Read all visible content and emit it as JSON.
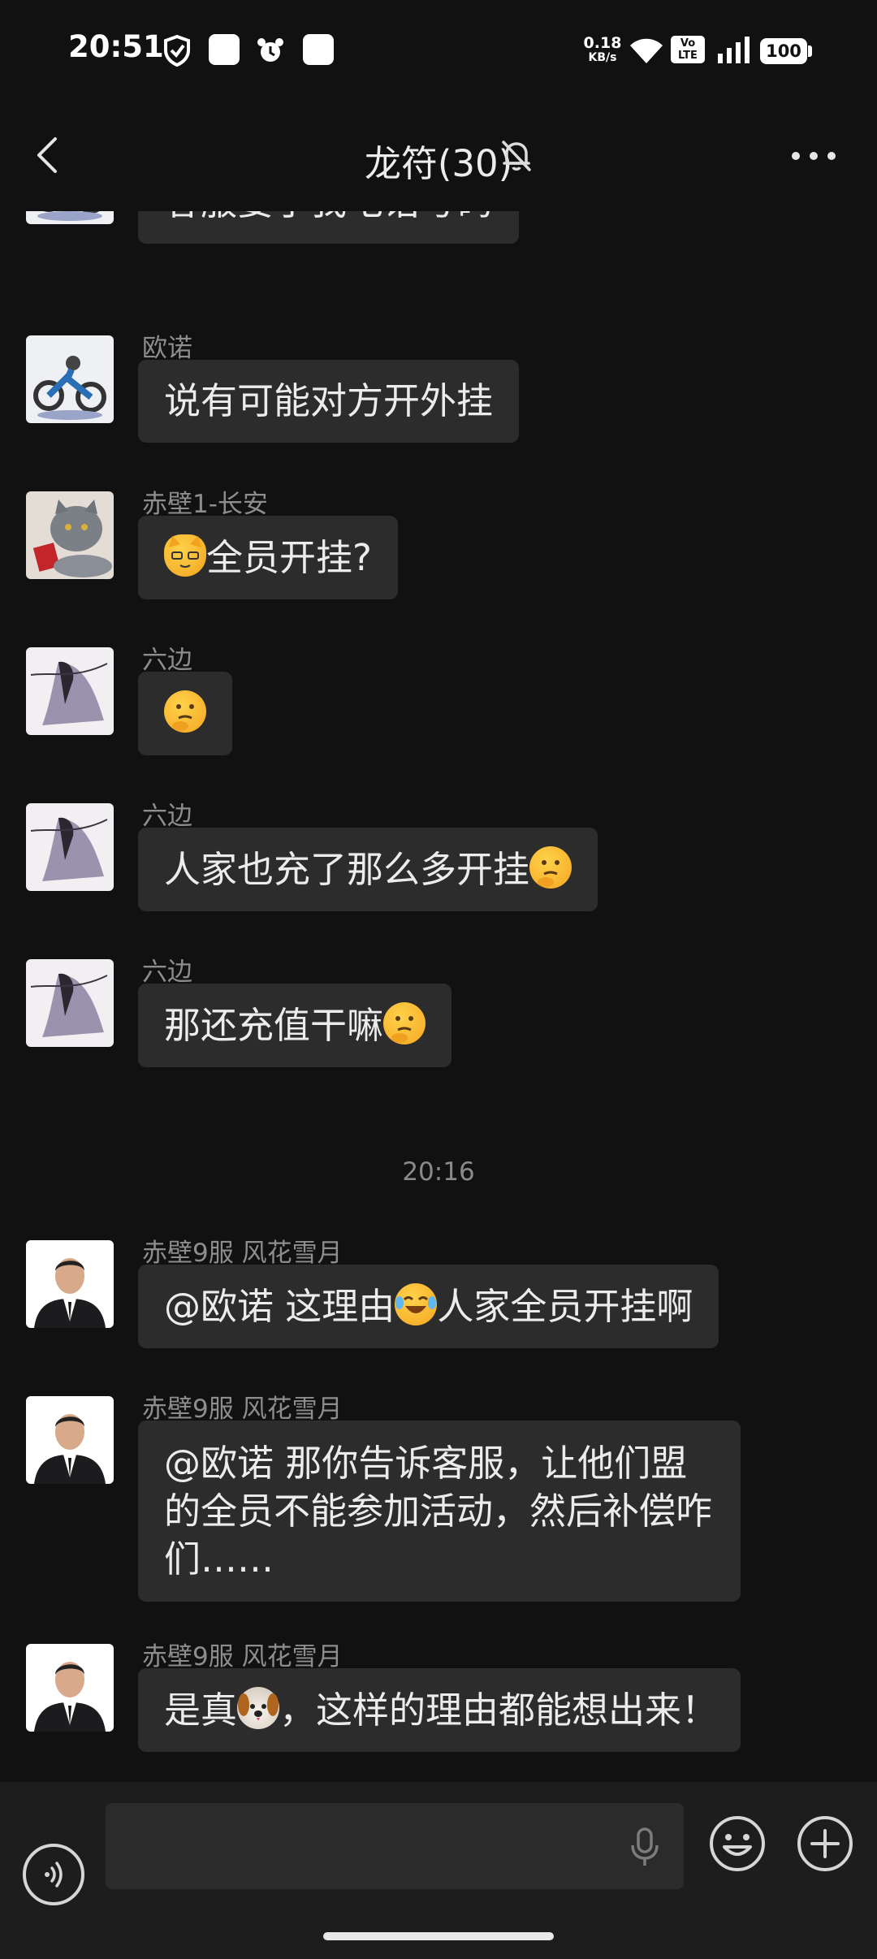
{
  "status_bar": {
    "time": "20:51",
    "net_speed_value": "0.18",
    "net_speed_unit": "KB/s",
    "volte": "Vo LTE",
    "battery": "100",
    "icons": [
      "shield-icon",
      "app-square-icon",
      "alarm-icon",
      "app-square-icon",
      "wifi-icon",
      "signal-icon",
      "battery-icon"
    ]
  },
  "header": {
    "title": "龙符(30)",
    "back_icon": "chevron-left-icon",
    "mute_icon": "bell-off-icon",
    "more_icon": "more-dots-icon"
  },
  "messages": [
    {
      "sender": "欧诺",
      "avatar": "motorcycle-avatar",
      "text": "客服要了我电话号码"
    },
    {
      "sender": "欧诺",
      "avatar": "motorcycle-avatar",
      "text": "说有可能对方开外挂"
    },
    {
      "sender": "赤壁1-长安",
      "avatar": "cat-avatar",
      "emoji_before": "cat-emoji",
      "text": "全员开挂?"
    },
    {
      "sender": "六边",
      "avatar": "anime-avatar",
      "emoji_only": "thinking-emoji"
    },
    {
      "sender": "六边",
      "avatar": "anime-avatar",
      "text": "人家也充了那么多开挂",
      "emoji_after": "thinking-emoji"
    },
    {
      "sender": "六边",
      "avatar": "anime-avatar",
      "text": "那还充值干嘛",
      "emoji_after": "thinking-emoji"
    }
  ],
  "time_divider": "20:16",
  "messages_after": [
    {
      "sender": "赤壁9服 风花雪月",
      "avatar": "man-suit-avatar",
      "text_before": "@欧诺  这理由",
      "emoji_mid": "laughing-tears-emoji",
      "text_after": "人家全员开挂啊"
    },
    {
      "sender": "赤壁9服 风花雪月",
      "avatar": "man-suit-avatar",
      "text": "@欧诺  那你告诉客服，让他们盟的全员不能参加活动，然后补偿咋们……"
    },
    {
      "sender": "赤壁9服 风花雪月",
      "avatar": "man-suit-avatar",
      "text_before": "是真",
      "emoji_mid": "dog-emoji",
      "text_after": "，这样的理由都能想出来！"
    }
  ],
  "input_bar": {
    "placeholder": "",
    "voice_icon": "voice-wave-icon",
    "mic_icon": "microphone-icon",
    "emoji_icon": "smiley-icon",
    "plus_icon": "plus-circle-icon"
  }
}
